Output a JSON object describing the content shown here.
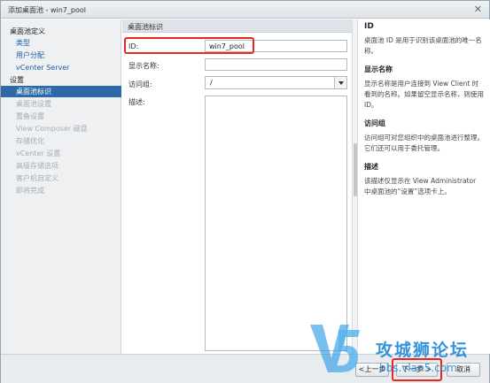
{
  "window": {
    "title": "添加桌面池 - win7_pool",
    "close_glyph": "✕"
  },
  "sidebar": {
    "items": [
      {
        "label": "桌面池定义",
        "kind": "head"
      },
      {
        "label": "类型",
        "kind": "link"
      },
      {
        "label": "用户分配",
        "kind": "link"
      },
      {
        "label": "vCenter Server",
        "kind": "link"
      },
      {
        "label": "设置",
        "kind": "head"
      },
      {
        "label": "桌面池标识",
        "kind": "active"
      },
      {
        "label": "桌面池设置",
        "kind": "disabled"
      },
      {
        "label": "置备设置",
        "kind": "disabled"
      },
      {
        "label": "View Composer 磁盘",
        "kind": "disabled"
      },
      {
        "label": "存储优化",
        "kind": "disabled"
      },
      {
        "label": "vCenter 设置",
        "kind": "disabled"
      },
      {
        "label": "高级存储选项",
        "kind": "disabled"
      },
      {
        "label": "客户机自定义",
        "kind": "disabled"
      },
      {
        "label": "即将完成",
        "kind": "disabled"
      }
    ]
  },
  "main": {
    "header": "桌面池标识",
    "fields": {
      "id": {
        "label": "ID:",
        "value": "win7_pool"
      },
      "display_name": {
        "label": "显示名称:",
        "value": ""
      },
      "access_group": {
        "label": "访问组:",
        "value": "/"
      },
      "description": {
        "label": "描述:",
        "value": ""
      }
    }
  },
  "help": {
    "sections": [
      {
        "title": "ID",
        "text": "桌面池 ID 是用于识别该桌面池的唯一名称。"
      },
      {
        "title": "显示名称",
        "text": "显示名称是用户连接到 View Client 时看到的名称。如果留空显示名称，则使用 ID。"
      },
      {
        "title": "访问组",
        "text": "访问组可对您组织中的桌面池进行整理。它们还可以用于委托管理。"
      },
      {
        "title": "描述",
        "text": "该描述仅显示在 View Administrator 中桌面池的“设置”选项卡上。"
      }
    ]
  },
  "footer": {
    "back_label": "<上一步",
    "next_label": "下一步 >",
    "cancel_label": "取消"
  },
  "watermark": {
    "logo": "V5",
    "title": "攻城狮论坛",
    "url": "bbs.vlan5.com",
    "colors": {
      "primary": "#1e88d8"
    }
  },
  "colors": {
    "accent": "#2f6aa8",
    "highlight": "#e8281c",
    "link": "#1b5fa6",
    "disabled": "#a7adb3"
  }
}
